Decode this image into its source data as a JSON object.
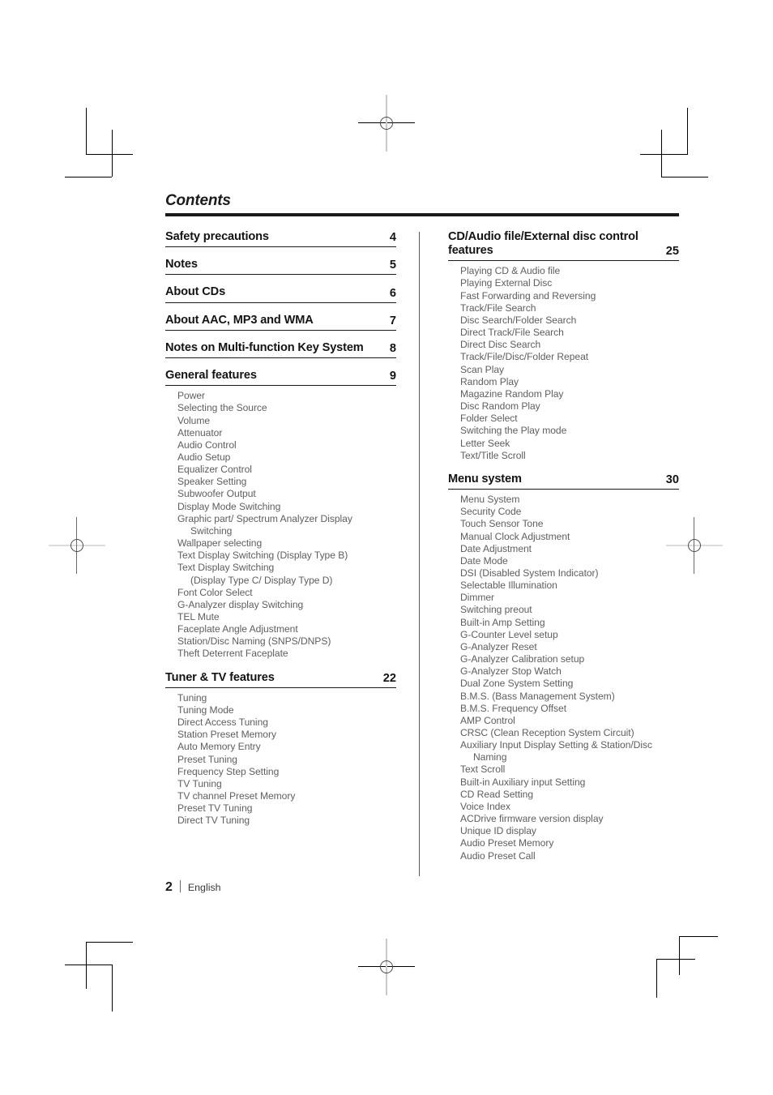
{
  "document": {
    "title": "Contents",
    "footer": {
      "page_number": "2",
      "separator": "|",
      "language": "English"
    }
  },
  "left_column": [
    {
      "heading": "Safety precautions",
      "page": "4",
      "items": []
    },
    {
      "heading": "Notes",
      "page": "5",
      "items": []
    },
    {
      "heading": "About CDs",
      "page": "6",
      "items": []
    },
    {
      "heading": "About AAC, MP3 and WMA",
      "page": "7",
      "items": []
    },
    {
      "heading": "Notes on Multi-function Key System",
      "page": "8",
      "items": []
    },
    {
      "heading": "General features",
      "page": "9",
      "items": [
        {
          "text": "Power"
        },
        {
          "text": "Selecting the Source"
        },
        {
          "text": "Volume"
        },
        {
          "text": "Attenuator"
        },
        {
          "text": "Audio Control"
        },
        {
          "text": "Audio Setup"
        },
        {
          "text": "Equalizer Control"
        },
        {
          "text": "Speaker Setting"
        },
        {
          "text": "Subwoofer Output"
        },
        {
          "text": "Display Mode Switching"
        },
        {
          "text": "Graphic part/ Spectrum Analyzer Display",
          "cont": "Switching"
        },
        {
          "text": "Wallpaper selecting"
        },
        {
          "text": "Text Display Switching (Display Type B)"
        },
        {
          "text": "Text Display Switching",
          "cont": "(Display Type C/ Display Type D)"
        },
        {
          "text": "Font Color Select"
        },
        {
          "text": "G-Analyzer display Switching"
        },
        {
          "text": "TEL Mute"
        },
        {
          "text": "Faceplate Angle Adjustment"
        },
        {
          "text": "Station/Disc Naming (SNPS/DNPS)"
        },
        {
          "text": "Theft Deterrent Faceplate"
        }
      ]
    },
    {
      "heading": "Tuner & TV features",
      "page": "22",
      "items": [
        {
          "text": "Tuning"
        },
        {
          "text": "Tuning Mode"
        },
        {
          "text": "Direct Access Tuning"
        },
        {
          "text": "Station Preset Memory"
        },
        {
          "text": "Auto Memory Entry"
        },
        {
          "text": "Preset Tuning"
        },
        {
          "text": "Frequency Step Setting"
        },
        {
          "text": "TV Tuning"
        },
        {
          "text": "TV channel Preset Memory"
        },
        {
          "text": "Preset TV Tuning"
        },
        {
          "text": "Direct TV Tuning"
        }
      ]
    }
  ],
  "right_column": [
    {
      "heading": "CD/Audio file/External disc control features",
      "page": "25",
      "items": [
        {
          "text": "Playing CD & Audio file"
        },
        {
          "text": "Playing External Disc"
        },
        {
          "text": "Fast Forwarding and Reversing"
        },
        {
          "text": "Track/File Search"
        },
        {
          "text": "Disc Search/Folder Search"
        },
        {
          "text": "Direct Track/File Search"
        },
        {
          "text": "Direct Disc Search"
        },
        {
          "text": "Track/File/Disc/Folder Repeat"
        },
        {
          "text": "Scan Play"
        },
        {
          "text": "Random Play"
        },
        {
          "text": "Magazine Random Play"
        },
        {
          "text": "Disc Random Play"
        },
        {
          "text": "Folder Select"
        },
        {
          "text": "Switching the Play mode"
        },
        {
          "text": "Letter Seek"
        },
        {
          "text": "Text/Title Scroll"
        }
      ]
    },
    {
      "heading": "Menu system",
      "page": "30",
      "items": [
        {
          "text": "Menu System"
        },
        {
          "text": "Security Code"
        },
        {
          "text": "Touch Sensor Tone"
        },
        {
          "text": "Manual Clock Adjustment"
        },
        {
          "text": "Date Adjustment"
        },
        {
          "text": "Date Mode"
        },
        {
          "text": "DSI (Disabled System Indicator)"
        },
        {
          "text": "Selectable Illumination"
        },
        {
          "text": "Dimmer"
        },
        {
          "text": "Switching preout"
        },
        {
          "text": "Built-in Amp Setting"
        },
        {
          "text": "G-Counter Level setup"
        },
        {
          "text": "G-Analyzer Reset"
        },
        {
          "text": "G-Analyzer Calibration setup"
        },
        {
          "text": "G-Analyzer Stop Watch"
        },
        {
          "text": "Dual Zone System Setting"
        },
        {
          "text": "B.M.S. (Bass Management System)"
        },
        {
          "text": "B.M.S. Frequency Offset"
        },
        {
          "text": "AMP Control"
        },
        {
          "text": "CRSC (Clean Reception System Circuit)"
        },
        {
          "text": "Auxiliary Input Display Setting & Station/Disc",
          "cont": "Naming"
        },
        {
          "text": "Text Scroll"
        },
        {
          "text": "Built-in Auxiliary input Setting"
        },
        {
          "text": "CD Read Setting"
        },
        {
          "text": "Voice Index"
        },
        {
          "text": "ACDrive firmware version display"
        },
        {
          "text": "Unique ID display"
        },
        {
          "text": "Audio Preset Memory"
        },
        {
          "text": "Audio Preset Call"
        }
      ]
    }
  ]
}
